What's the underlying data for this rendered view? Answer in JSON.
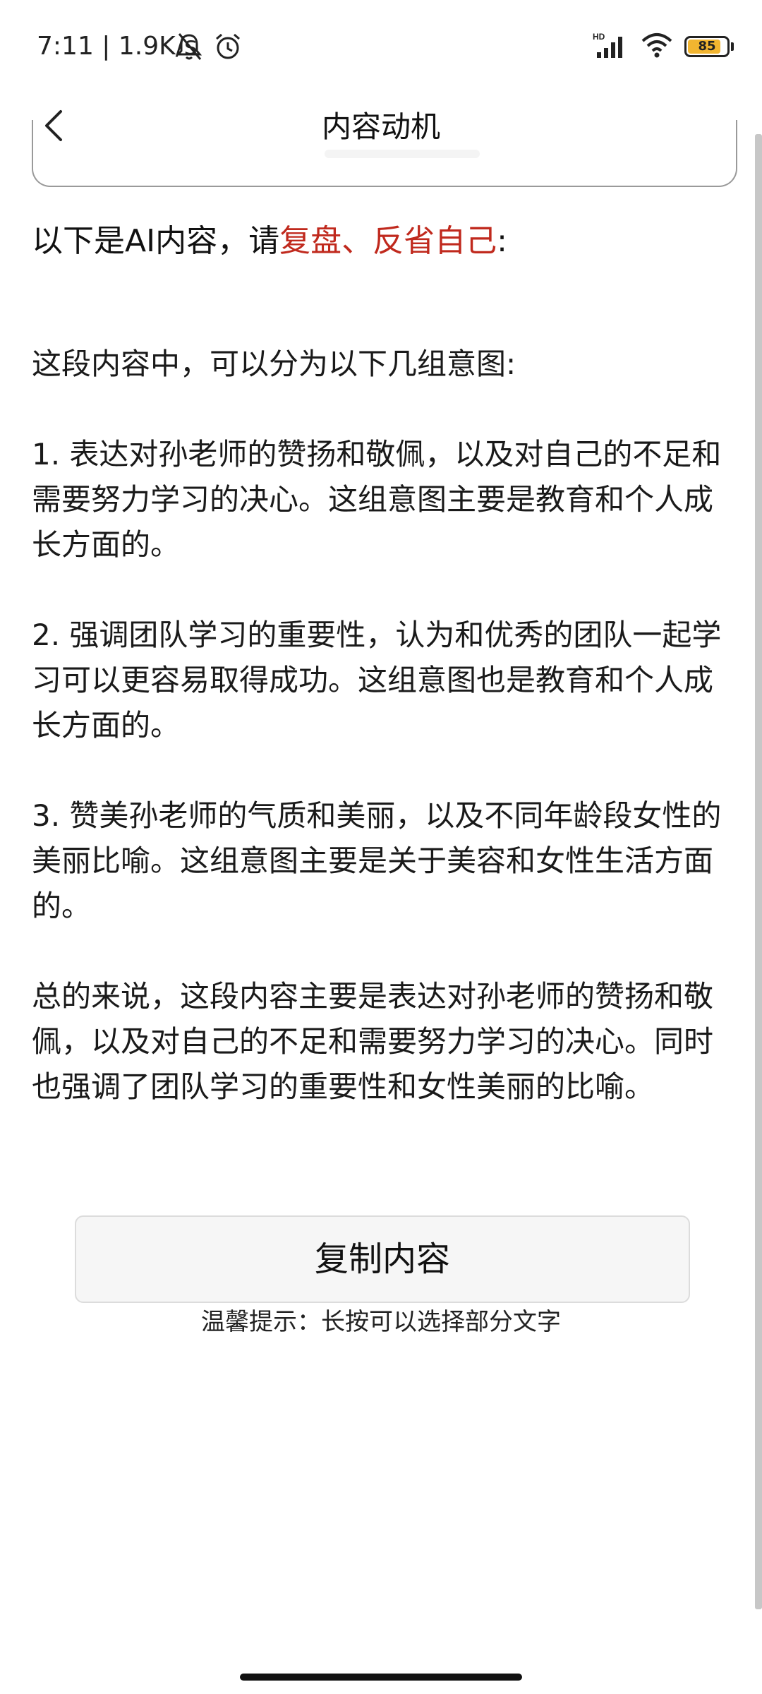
{
  "status_bar": {
    "time": "7:11 | 1.9K/s",
    "network_label": "HD",
    "battery_percent": 85,
    "battery_label": "85",
    "icons": [
      "bell-off-icon",
      "alarm-icon",
      "signal-icon",
      "wifi-icon",
      "battery-icon"
    ]
  },
  "header": {
    "title": "内容动机",
    "back_icon": "chevron-left-icon"
  },
  "content": {
    "intro_prefix": "以下是AI内容，请",
    "intro_highlight": "复盘、反省自己",
    "intro_suffix": ":",
    "intro_highlight_color": "#c0291d",
    "lead": "这段内容中，可以分为以下几组意图:",
    "items": [
      "1. 表达对孙老师的赞扬和敬佩，以及对自己的不足和需要努力学习的决心。这组意图主要是教育和个人成长方面的。",
      "2. 强调团队学习的重要性，认为和优秀的团队一起学习可以更容易取得成功。这组意图也是教育和个人成长方面的。",
      "3. 赞美孙老师的气质和美丽，以及不同年龄段女性的美丽比喻。这组意图主要是关于美容和女性生活方面的。"
    ],
    "summary": "总的来说，这段内容主要是表达对孙老师的赞扬和敬佩，以及对自己的不足和需要努力学习的决心。同时也强调了团队学习的重要性和女性美丽的比喻。"
  },
  "actions": {
    "copy_label": "复制内容",
    "tip": "温馨提示：长按可以选择部分文字"
  }
}
